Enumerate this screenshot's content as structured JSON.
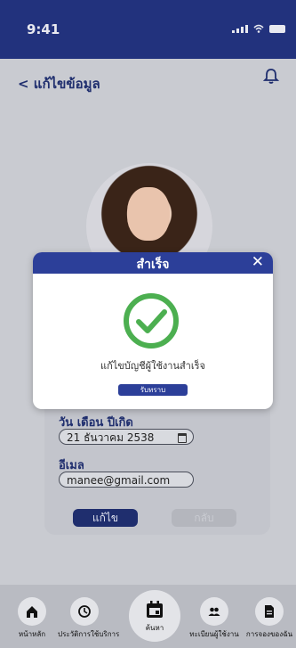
{
  "status": {
    "time": "9:41"
  },
  "header": {
    "back_label": "< แก้ไขข้อมูล"
  },
  "form": {
    "birthdate_label": "วัน เดือน ปีเกิด",
    "birthdate_value": "21 ธันวาคม 2538",
    "email_label": "อีเมล",
    "email_value": "manee@gmail.com",
    "edit_button": "แก้ไข",
    "back_button": "กลับ"
  },
  "modal": {
    "title": "สำเร็จ",
    "close": "✕",
    "message": "แก้ไขบัญชีผู้ใช้งานสำเร็จ",
    "ok_button": "รับทราบ"
  },
  "nav": {
    "items": [
      {
        "label": "หน้าหลัก",
        "icon": "home-icon"
      },
      {
        "label": "ประวัติการใช้บริการ",
        "icon": "history-icon"
      },
      {
        "label": "ค้นหา",
        "icon": "calendar-icon"
      },
      {
        "label": "ทะเบียนผู้ใช้งาน",
        "icon": "users-icon"
      },
      {
        "label": "การจองของฉัน",
        "icon": "document-icon"
      }
    ]
  },
  "colors": {
    "primary": "#2c3f99",
    "success": "#4caf50",
    "statusbar": "#22327d"
  }
}
